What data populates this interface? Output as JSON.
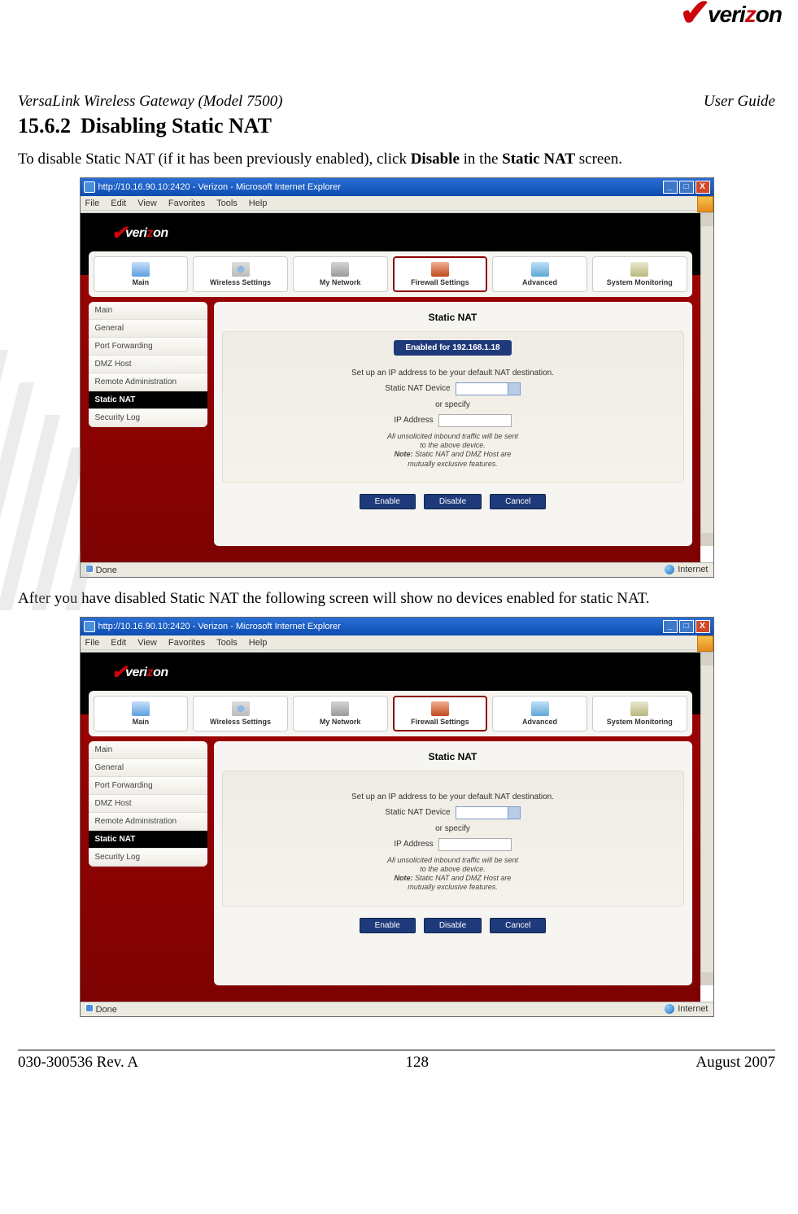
{
  "page": {
    "product": "VersaLink Wireless Gateway (Model 7500)",
    "doc_type": "User Guide",
    "section_num": "15.6.2",
    "section_title": "Disabling Static NAT",
    "para1_a": "To disable Static NAT (if it has been previously enabled), click ",
    "para1_b": "Disable",
    "para1_c": " in the ",
    "para1_d": "Static NAT",
    "para1_e": " screen.",
    "para2": "After you have disabled Static NAT the following screen will show no devices enabled for static NAT.",
    "footer_left": "030-300536 Rev. A",
    "footer_center": "128",
    "footer_right": "August 2007",
    "logo_brand_a": "veri",
    "logo_brand_b": "z",
    "logo_brand_c": "on"
  },
  "browser": {
    "title": "http://10.16.90.10:2420 - Verizon - Microsoft Internet Explorer",
    "menus": [
      "File",
      "Edit",
      "View",
      "Favorites",
      "Tools",
      "Help"
    ],
    "status_left": "Done",
    "status_right": "Internet"
  },
  "app": {
    "brand_a": "veri",
    "brand_b": "z",
    "brand_c": "on",
    "nav": [
      {
        "label": "Main"
      },
      {
        "label": "Wireless Settings"
      },
      {
        "label": "My Network"
      },
      {
        "label": "Firewall Settings"
      },
      {
        "label": "Advanced"
      },
      {
        "label": "System Monitoring"
      }
    ],
    "side": [
      "Main",
      "General",
      "Port Forwarding",
      "DMZ Host",
      "Remote Administration",
      "Static NAT",
      "Security Log"
    ],
    "panel_title": "Static NAT",
    "enabled_badge": "Enabled for 192.168.1.18",
    "instr": "Set up an IP address to be your default NAT destination.",
    "dev_label": "Static NAT Device",
    "or_specify": "or specify",
    "ip_label": "IP Address",
    "note_a": "All unsolicited inbound traffic will be sent",
    "note_b": "to the above device.",
    "note_c": "Note:",
    "note_d": " Static NAT and DMZ Host are",
    "note_e": "mutually exclusive features.",
    "btn_enable": "Enable",
    "btn_disable": "Disable",
    "btn_cancel": "Cancel"
  }
}
